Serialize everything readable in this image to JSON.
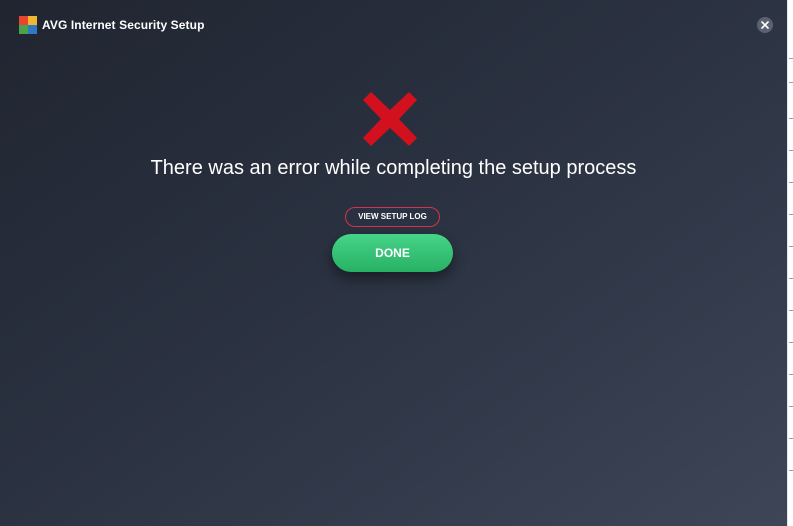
{
  "window": {
    "title": "AVG Internet Security Setup"
  },
  "icons": {
    "logo": "avg-logo-icon",
    "error": "error-x-icon",
    "close": "close-icon"
  },
  "main": {
    "message": "There was an error while completing the setup process",
    "view_log_label": "VIEW SETUP LOG",
    "done_label": "DONE"
  },
  "colors": {
    "error_red": "#d3101e",
    "done_green": "#33c073",
    "log_border": "#d0354f",
    "background_dark": "#202530",
    "background_light": "#3d4557"
  }
}
